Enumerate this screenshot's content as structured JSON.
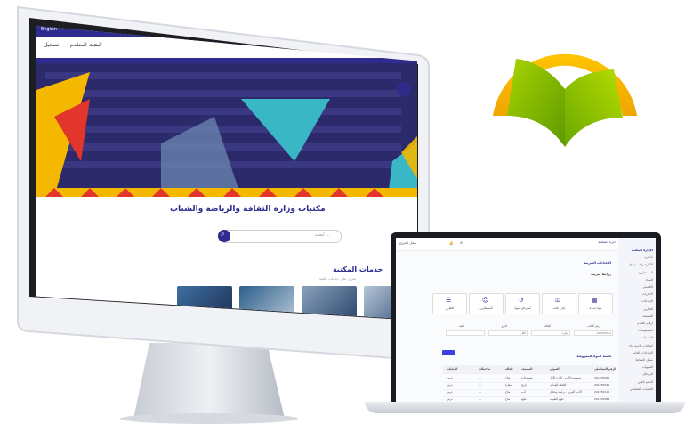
{
  "monitor": {
    "lang": "English",
    "search_label": "البحث المتقدم",
    "login_label": "تسجيل",
    "hero_title": "مكتبات وزارة الثقافة والرياضة والشباب",
    "hero_search_placeholder": "ابحث ...",
    "services_title": "خدمات المكتبة",
    "services_subtitle": "تعرف على خدمات مكتبة"
  },
  "laptop": {
    "brand": "إدارة المكتبة",
    "user": "سجل الخروج",
    "sidebar": [
      "الإدارة المكتبة",
      "الأعارة",
      "الأعارة والاسترجاع",
      "المستعارين",
      "المواد",
      "الاقسام",
      "الاعارات",
      "الإعدادات",
      "التقارير",
      "التصنيف",
      "أرقام الخادم",
      "المجموعات",
      "الحسابات",
      "إعدادات الاسترجاع",
      "الإعدادات العامة",
      "سجل النشاط",
      "التنبيهات",
      "الرسائل",
      "الدعم الفني",
      "الحساب الشخصي"
    ],
    "page_title": "الإعدادات السريعة",
    "quick_links_title": "روابط سريعة",
    "quick_buttons": [
      {
        "label": "مواد جديدة",
        "icon": "grid-icon"
      },
      {
        "label": "إعارة كتاب",
        "icon": "key-icon"
      },
      {
        "label": "استرجاع المواد",
        "icon": "return-icon"
      },
      {
        "label": "المستعارين",
        "icon": "users-icon"
      },
      {
        "label": "التقارير",
        "icon": "report-icon"
      }
    ],
    "filters": [
      {
        "label": "رقم الكتاب",
        "value": "0000000-X"
      },
      {
        "label": "الحالة",
        "value": "معارة"
      },
      {
        "label": "النوع",
        "value": "الكل"
      },
      {
        "label": "الفئة",
        "value": ""
      }
    ],
    "table_title": "قائمة المواد المعروضة",
    "table_headers": [
      "الرقم التسلسلي",
      "العنوان",
      "التصنيف",
      "الحالة",
      "ملاحظات",
      "العمليات"
    ],
    "table_rows": [
      [
        "201230001",
        "موسوعة الأدب - الجزء الأول",
        "موسوعات",
        "متاح",
        "—",
        "عرض"
      ],
      [
        "201230045",
        "الثقافة العمانية",
        "تاريخ",
        "معارة",
        "—",
        "عرض"
      ],
      [
        "201230110",
        "الأدب العربي - دراسة وتحليل",
        "أدب",
        "متاح",
        "—",
        "عرض"
      ],
      [
        "201230088",
        "علوم الطبيعة",
        "علوم",
        "متاح",
        "—",
        "عرض"
      ],
      [
        "201230012",
        "موسوعة الرياضة والشباب",
        "موسوعات",
        "متاح",
        "إعارة سابقة",
        "عرض"
      ],
      [
        "201230036",
        "موسوعة الأدب - الجزء الثاني",
        "موسوعات",
        "متاح",
        "—",
        "عرض"
      ],
      [
        "201230040",
        "الثقافة والمجتمع",
        "تاريخ",
        "متاح",
        "—",
        "عرض"
      ]
    ]
  },
  "colors": {
    "brand": "#2f2b8f",
    "accent": "#3c3fe1",
    "logo_arc": "#f4b800",
    "logo_book": "#7cb800"
  }
}
